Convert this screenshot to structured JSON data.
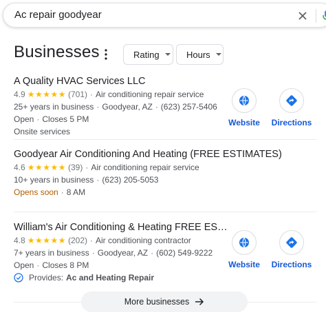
{
  "search": {
    "query": "Ac repair goodyear"
  },
  "section": {
    "title": "Businesses"
  },
  "filters": [
    {
      "label": "Rating"
    },
    {
      "label": "Hours"
    }
  ],
  "listings": [
    {
      "name": "A Quality HVAC Services LLC",
      "rating": "4.9",
      "stars": "★★★★★",
      "reviews": "(701)",
      "category": "Air conditioning repair service",
      "years": "25+ years in business",
      "location": "Goodyear, AZ",
      "phone": "(623) 257-5406",
      "status": "Open",
      "hours": "Closes 5 PM",
      "extra": "Onsite services",
      "website_label": "Website",
      "directions_label": "Directions"
    },
    {
      "name": "Goodyear Air Conditioning And Heating (FREE ESTIMATES)",
      "rating": "4.6",
      "stars": "★★★★★",
      "reviews": "(39)",
      "category": "Air conditioning repair service",
      "years": "10+ years in business",
      "phone": "(623) 205-5053",
      "status": "Opens soon",
      "hours": "8 AM"
    },
    {
      "name": "William's Air Conditioning & Heating FREE ES…",
      "rating": "4.8",
      "stars": "★★★★★",
      "reviews": "(202)",
      "category": "Air conditioning contractor",
      "years": "7+ years in business",
      "location": "Goodyear, AZ",
      "phone": "(602) 549-9222",
      "status": "Open",
      "hours": "Closes 8 PM",
      "provides_prefix": "Provides:",
      "provides_value": "Ac and Heating Repair",
      "website_label": "Website",
      "directions_label": "Directions"
    }
  ],
  "more_button": {
    "label": "More businesses"
  },
  "colors": {
    "star": "#fbbc04",
    "link": "#1558d6",
    "opens_soon": "#b05c00"
  }
}
